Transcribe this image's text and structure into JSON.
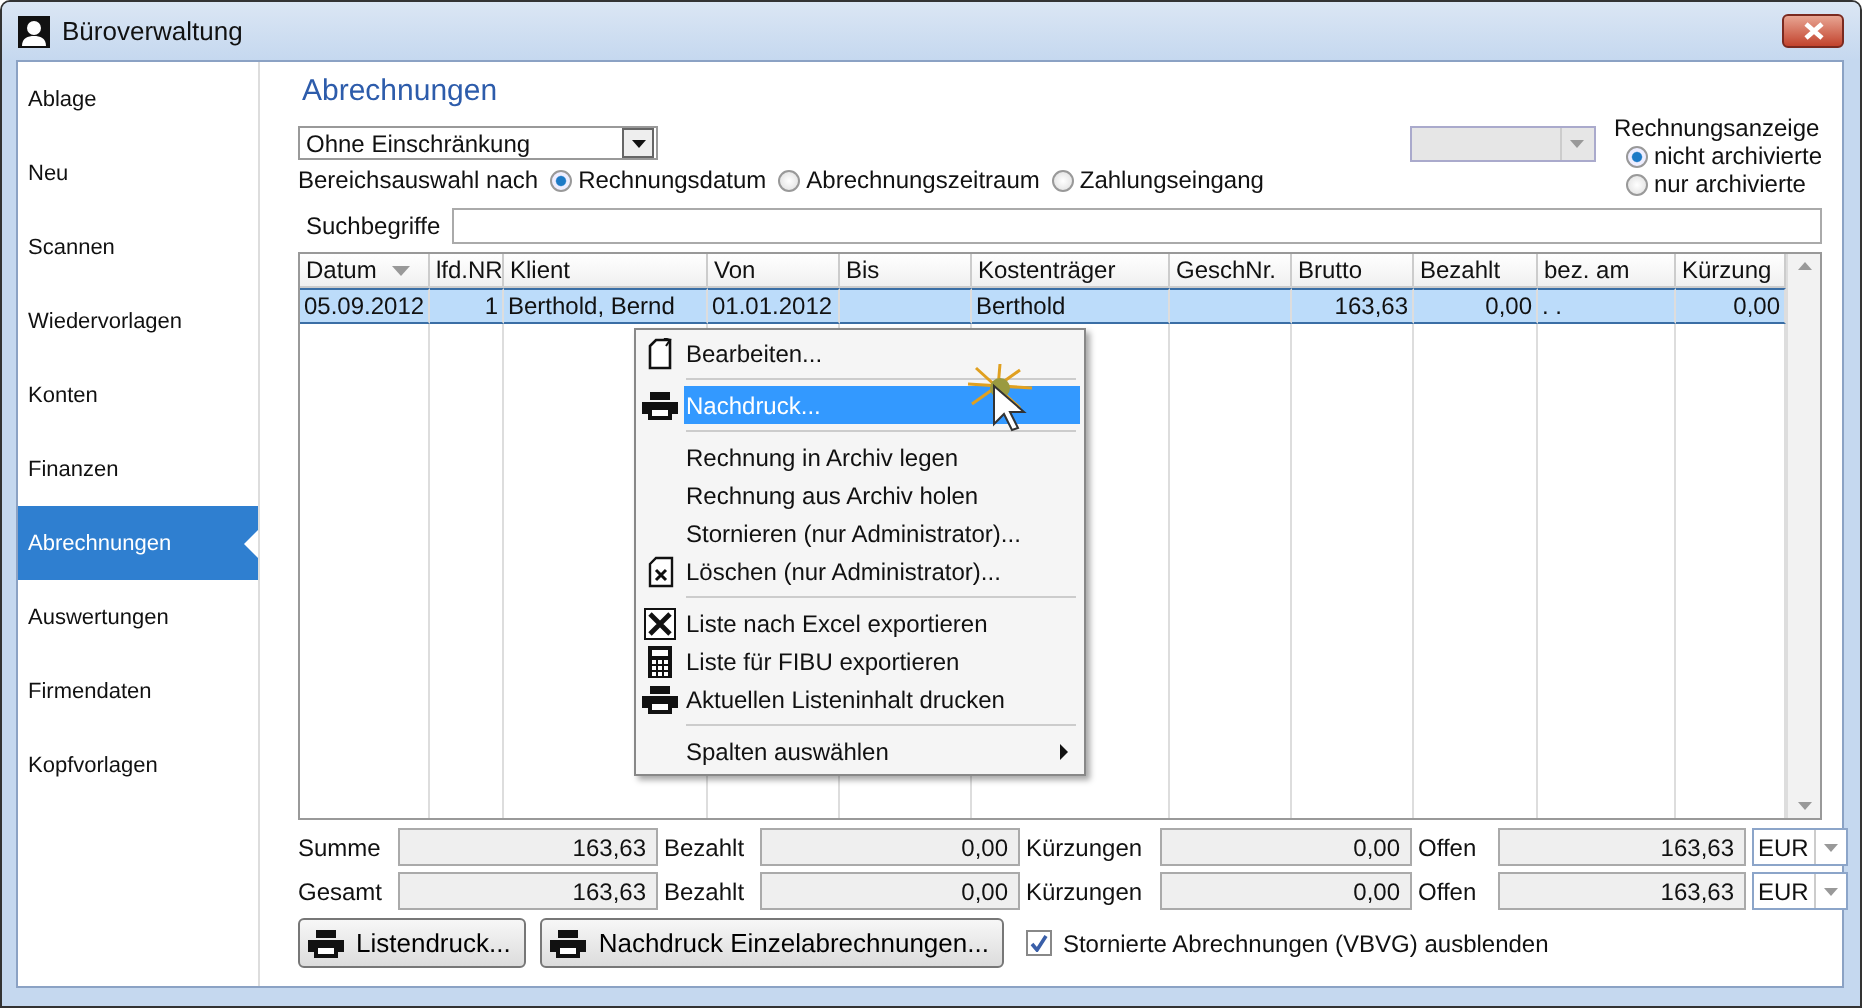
{
  "window": {
    "title": "Büroverwaltung"
  },
  "sidebar": {
    "items": [
      {
        "label": "Ablage",
        "selected": false
      },
      {
        "label": "Neu",
        "selected": false
      },
      {
        "label": "Scannen",
        "selected": false
      },
      {
        "label": "Wiedervorlagen",
        "selected": false
      },
      {
        "label": "Konten",
        "selected": false
      },
      {
        "label": "Finanzen",
        "selected": false
      },
      {
        "label": "Abrechnungen",
        "selected": true
      },
      {
        "label": "Auswertungen",
        "selected": false
      },
      {
        "label": "Firmendaten",
        "selected": false
      },
      {
        "label": "Kopfvorlagen",
        "selected": false
      }
    ]
  },
  "page_title": "Abrechnungen",
  "filter": {
    "value": "Ohne Einschränkung"
  },
  "range": {
    "label": "Bereichsauswahl nach",
    "options": [
      {
        "label": "Rechnungsdatum",
        "selected": true
      },
      {
        "label": "Abrechnungszeitraum",
        "selected": false
      },
      {
        "label": "Zahlungseingang",
        "selected": false
      }
    ]
  },
  "secondary_select": {
    "disabled": true
  },
  "invoice_display": {
    "label": "Rechnungsanzeige",
    "options": [
      {
        "label": "nicht archivierte",
        "selected": true
      },
      {
        "label": "nur archivierte",
        "selected": false
      }
    ]
  },
  "search": {
    "label": "Suchbegriffe"
  },
  "table": {
    "columns": [
      {
        "label": "Datum",
        "sorted": true
      },
      {
        "label": "lfd.NR"
      },
      {
        "label": "Klient"
      },
      {
        "label": "Von"
      },
      {
        "label": "Bis"
      },
      {
        "label": "Kostenträger"
      },
      {
        "label": "GeschNr."
      },
      {
        "label": "Brutto"
      },
      {
        "label": "Bezahlt"
      },
      {
        "label": "bez. am"
      },
      {
        "label": "Kürzung"
      }
    ],
    "rows": [
      {
        "selected": true,
        "cells": [
          "05.09.2012",
          "1",
          "Berthold, Bernd",
          "01.01.2012",
          null,
          "Berthold",
          null,
          "163,63",
          "0,00",
          ". .",
          "0,00"
        ]
      }
    ]
  },
  "context_menu": {
    "items": [
      {
        "kind": "edit",
        "label": "Bearbeiten...",
        "selected": false
      },
      {
        "kind": "separator"
      },
      {
        "kind": "print",
        "label": "Nachdruck...",
        "selected": true
      },
      {
        "kind": "separator"
      },
      {
        "kind": "plain",
        "label": "Rechnung in Archiv legen",
        "selected": false
      },
      {
        "kind": "plain",
        "label": "Rechnung aus Archiv holen",
        "selected": false
      },
      {
        "kind": "plain",
        "label": "Stornieren (nur Administrator)...",
        "selected": false
      },
      {
        "kind": "delete",
        "label": "Löschen (nur Administrator)...",
        "selected": false
      },
      {
        "kind": "separator"
      },
      {
        "kind": "excel",
        "label": "Liste nach Excel exportieren",
        "selected": false
      },
      {
        "kind": "calculator",
        "label": "Liste für FIBU exportieren",
        "selected": false
      },
      {
        "kind": "print",
        "label": "Aktuellen Listeninhalt drucken",
        "selected": false
      },
      {
        "kind": "separator"
      },
      {
        "kind": "submenu",
        "label": "Spalten auswählen",
        "selected": false
      }
    ]
  },
  "totals": [
    {
      "label": "Summe",
      "sum": "163,63",
      "paid_label": "Bezahlt",
      "paid": "0,00",
      "cuts_label": "Kürzungen",
      "cuts": "0,00",
      "open_label": "Offen",
      "open": "163,63",
      "currency": "EUR"
    },
    {
      "label": "Gesamt",
      "sum": "163,63",
      "paid_label": "Bezahlt",
      "paid": "0,00",
      "cuts_label": "Kürzungen",
      "cuts": "0,00",
      "open_label": "Offen",
      "open": "163,63",
      "currency": "EUR"
    }
  ],
  "buttons": [
    {
      "label": "Listendruck..."
    },
    {
      "label": "Nachdruck Einzelabrechnungen..."
    }
  ],
  "hide_cancelled": {
    "label": "Stornierte Abrechnungen (VBVG) ausblenden",
    "checked": true
  }
}
